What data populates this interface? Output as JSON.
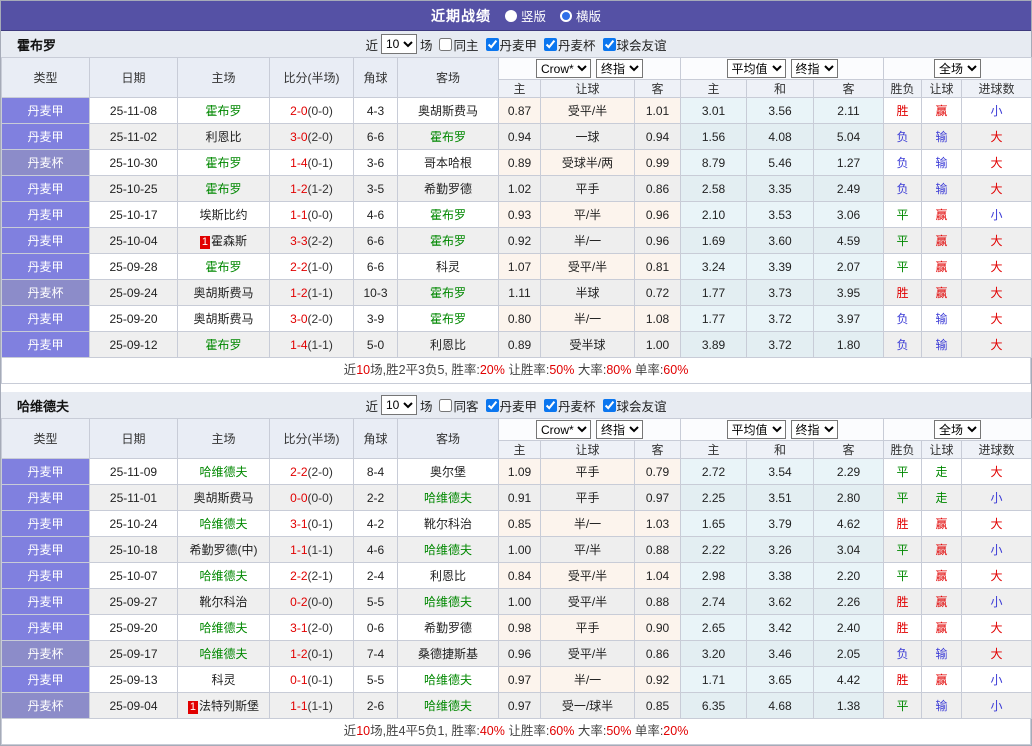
{
  "page": {
    "title": "近期战绩",
    "radio_options": [
      {
        "label": "竖版",
        "selected": true
      },
      {
        "label": "横版",
        "selected": false
      }
    ]
  },
  "colors": {
    "titlebar_bg": "#5551a5",
    "checkbox_accent": "#0b76ef",
    "score_red": "#e10000",
    "focus_team_green": "#008800",
    "league_badge": {
      "丹麦甲": "#8080df",
      "丹麦杯": "#8c8cc9"
    },
    "outcome": {
      "胜": "#e10000",
      "平": "#008800",
      "负": "#3c3cd6",
      "赢": "#e10000",
      "走": "#008800",
      "输": "#3c3cd6",
      "大": "#e10000",
      "小": "#3c3cd6"
    }
  },
  "filter_labels": {
    "near": "近",
    "count": "10",
    "games": "场",
    "leagues": [
      "丹麦甲",
      "丹麦杯",
      "球会友谊"
    ]
  },
  "header": {
    "cols": {
      "type": "类型",
      "date": "日期",
      "home": "主场",
      "score": "比分(半场)",
      "corner": "角球",
      "away": "客场"
    },
    "groups": {
      "crow": "Crow*",
      "crow_stage": "终指",
      "avg": "平均值",
      "avg_stage": "终指",
      "full": "全场"
    },
    "sub": [
      "主",
      "让球",
      "客",
      "主",
      "和",
      "客",
      "胜负",
      "让球",
      "进球数"
    ]
  },
  "sections": [
    {
      "team": "霍布罗",
      "same_label": "同主",
      "rows": [
        {
          "league": "丹麦甲",
          "date": "25-11-08",
          "home": "霍布罗",
          "home_focus": true,
          "home_badge": "",
          "score": "2-0",
          "half": "(0-0)",
          "corner": "4-3",
          "away": "奥胡斯费马",
          "away_focus": false,
          "odds": [
            "0.87",
            "受平/半",
            "1.01"
          ],
          "avg": [
            "3.01",
            "3.56",
            "2.11"
          ],
          "res": [
            "胜",
            "赢",
            "小"
          ]
        },
        {
          "league": "丹麦甲",
          "date": "25-11-02",
          "home": "利恩比",
          "home_focus": false,
          "home_badge": "",
          "score": "3-0",
          "half": "(2-0)",
          "corner": "6-6",
          "away": "霍布罗",
          "away_focus": true,
          "odds": [
            "0.94",
            "一球",
            "0.94"
          ],
          "avg": [
            "1.56",
            "4.08",
            "5.04"
          ],
          "res": [
            "负",
            "输",
            "大"
          ]
        },
        {
          "league": "丹麦杯",
          "date": "25-10-30",
          "home": "霍布罗",
          "home_focus": true,
          "home_badge": "",
          "score": "1-4",
          "half": "(0-1)",
          "corner": "3-6",
          "away": "哥本哈根",
          "away_focus": false,
          "odds": [
            "0.89",
            "受球半/两",
            "0.99"
          ],
          "avg": [
            "8.79",
            "5.46",
            "1.27"
          ],
          "res": [
            "负",
            "输",
            "大"
          ]
        },
        {
          "league": "丹麦甲",
          "date": "25-10-25",
          "home": "霍布罗",
          "home_focus": true,
          "home_badge": "",
          "score": "1-2",
          "half": "(1-2)",
          "corner": "3-5",
          "away": "希勤罗德",
          "away_focus": false,
          "odds": [
            "1.02",
            "平手",
            "0.86"
          ],
          "avg": [
            "2.58",
            "3.35",
            "2.49"
          ],
          "res": [
            "负",
            "输",
            "大"
          ]
        },
        {
          "league": "丹麦甲",
          "date": "25-10-17",
          "home": "埃斯比约",
          "home_focus": false,
          "home_badge": "",
          "score": "1-1",
          "half": "(0-0)",
          "corner": "4-6",
          "away": "霍布罗",
          "away_focus": true,
          "odds": [
            "0.93",
            "平/半",
            "0.96"
          ],
          "avg": [
            "2.10",
            "3.53",
            "3.06"
          ],
          "res": [
            "平",
            "赢",
            "小"
          ]
        },
        {
          "league": "丹麦甲",
          "date": "25-10-04",
          "home": "霍森斯",
          "home_focus": false,
          "home_badge": "1",
          "score": "3-3",
          "half": "(2-2)",
          "corner": "6-6",
          "away": "霍布罗",
          "away_focus": true,
          "odds": [
            "0.92",
            "半/一",
            "0.96"
          ],
          "avg": [
            "1.69",
            "3.60",
            "4.59"
          ],
          "res": [
            "平",
            "赢",
            "大"
          ]
        },
        {
          "league": "丹麦甲",
          "date": "25-09-28",
          "home": "霍布罗",
          "home_focus": true,
          "home_badge": "",
          "score": "2-2",
          "half": "(1-0)",
          "corner": "6-6",
          "away": "科灵",
          "away_focus": false,
          "odds": [
            "1.07",
            "受平/半",
            "0.81"
          ],
          "avg": [
            "3.24",
            "3.39",
            "2.07"
          ],
          "res": [
            "平",
            "赢",
            "大"
          ]
        },
        {
          "league": "丹麦杯",
          "date": "25-09-24",
          "home": "奥胡斯费马",
          "home_focus": false,
          "home_badge": "",
          "score": "1-2",
          "half": "(1-1)",
          "corner": "10-3",
          "away": "霍布罗",
          "away_focus": true,
          "odds": [
            "1.11",
            "半球",
            "0.72"
          ],
          "avg": [
            "1.77",
            "3.73",
            "3.95"
          ],
          "res": [
            "胜",
            "赢",
            "大"
          ]
        },
        {
          "league": "丹麦甲",
          "date": "25-09-20",
          "home": "奥胡斯费马",
          "home_focus": false,
          "home_badge": "",
          "score": "3-0",
          "half": "(2-0)",
          "corner": "3-9",
          "away": "霍布罗",
          "away_focus": true,
          "odds": [
            "0.80",
            "半/一",
            "1.08"
          ],
          "avg": [
            "1.77",
            "3.72",
            "3.97"
          ],
          "res": [
            "负",
            "输",
            "大"
          ]
        },
        {
          "league": "丹麦甲",
          "date": "25-09-12",
          "home": "霍布罗",
          "home_focus": true,
          "home_badge": "",
          "score": "1-4",
          "half": "(1-1)",
          "corner": "5-0",
          "away": "利恩比",
          "away_focus": false,
          "odds": [
            "0.89",
            "受半球",
            "1.00"
          ],
          "avg": [
            "3.89",
            "3.72",
            "1.80"
          ],
          "res": [
            "负",
            "输",
            "大"
          ]
        }
      ],
      "summary": [
        "近",
        "10",
        "场,胜2平3负5, 胜率:",
        "20%",
        " 让胜率:",
        "50%",
        " 大率:",
        "80%",
        " 单率:",
        "60%"
      ]
    },
    {
      "team": "哈维德夫",
      "same_label": "同客",
      "rows": [
        {
          "league": "丹麦甲",
          "date": "25-11-09",
          "home": "哈维德夫",
          "home_focus": true,
          "home_badge": "",
          "score": "2-2",
          "half": "(2-0)",
          "corner": "8-4",
          "away": "奥尔堡",
          "away_focus": false,
          "odds": [
            "1.09",
            "平手",
            "0.79"
          ],
          "avg": [
            "2.72",
            "3.54",
            "2.29"
          ],
          "res": [
            "平",
            "走",
            "大"
          ]
        },
        {
          "league": "丹麦甲",
          "date": "25-11-01",
          "home": "奥胡斯费马",
          "home_focus": false,
          "home_badge": "",
          "score": "0-0",
          "half": "(0-0)",
          "corner": "2-2",
          "away": "哈维德夫",
          "away_focus": true,
          "odds": [
            "0.91",
            "平手",
            "0.97"
          ],
          "avg": [
            "2.25",
            "3.51",
            "2.80"
          ],
          "res": [
            "平",
            "走",
            "小"
          ]
        },
        {
          "league": "丹麦甲",
          "date": "25-10-24",
          "home": "哈维德夫",
          "home_focus": true,
          "home_badge": "",
          "score": "3-1",
          "half": "(0-1)",
          "corner": "4-2",
          "away": "靴尔科治",
          "away_focus": false,
          "odds": [
            "0.85",
            "半/一",
            "1.03"
          ],
          "avg": [
            "1.65",
            "3.79",
            "4.62"
          ],
          "res": [
            "胜",
            "赢",
            "大"
          ]
        },
        {
          "league": "丹麦甲",
          "date": "25-10-18",
          "home": "希勤罗德(中)",
          "home_focus": false,
          "home_badge": "",
          "score": "1-1",
          "half": "(1-1)",
          "corner": "4-6",
          "away": "哈维德夫",
          "away_focus": true,
          "odds": [
            "1.00",
            "平/半",
            "0.88"
          ],
          "avg": [
            "2.22",
            "3.26",
            "3.04"
          ],
          "res": [
            "平",
            "赢",
            "小"
          ]
        },
        {
          "league": "丹麦甲",
          "date": "25-10-07",
          "home": "哈维德夫",
          "home_focus": true,
          "home_badge": "",
          "score": "2-2",
          "half": "(2-1)",
          "corner": "2-4",
          "away": "利恩比",
          "away_focus": false,
          "odds": [
            "0.84",
            "受平/半",
            "1.04"
          ],
          "avg": [
            "2.98",
            "3.38",
            "2.20"
          ],
          "res": [
            "平",
            "赢",
            "大"
          ]
        },
        {
          "league": "丹麦甲",
          "date": "25-09-27",
          "home": "靴尔科治",
          "home_focus": false,
          "home_badge": "",
          "score": "0-2",
          "half": "(0-0)",
          "corner": "5-5",
          "away": "哈维德夫",
          "away_focus": true,
          "odds": [
            "1.00",
            "受平/半",
            "0.88"
          ],
          "avg": [
            "2.74",
            "3.62",
            "2.26"
          ],
          "res": [
            "胜",
            "赢",
            "小"
          ]
        },
        {
          "league": "丹麦甲",
          "date": "25-09-20",
          "home": "哈维德夫",
          "home_focus": true,
          "home_badge": "",
          "score": "3-1",
          "half": "(2-0)",
          "corner": "0-6",
          "away": "希勤罗德",
          "away_focus": false,
          "odds": [
            "0.98",
            "平手",
            "0.90"
          ],
          "avg": [
            "2.65",
            "3.42",
            "2.40"
          ],
          "res": [
            "胜",
            "赢",
            "大"
          ]
        },
        {
          "league": "丹麦杯",
          "date": "25-09-17",
          "home": "哈维德夫",
          "home_focus": true,
          "home_badge": "",
          "score": "1-2",
          "half": "(0-1)",
          "corner": "7-4",
          "away": "桑德捷斯基",
          "away_focus": false,
          "odds": [
            "0.96",
            "受平/半",
            "0.86"
          ],
          "avg": [
            "3.20",
            "3.46",
            "2.05"
          ],
          "res": [
            "负",
            "输",
            "大"
          ]
        },
        {
          "league": "丹麦甲",
          "date": "25-09-13",
          "home": "科灵",
          "home_focus": false,
          "home_badge": "",
          "score": "0-1",
          "half": "(0-1)",
          "corner": "5-5",
          "away": "哈维德夫",
          "away_focus": true,
          "odds": [
            "0.97",
            "半/一",
            "0.92"
          ],
          "avg": [
            "1.71",
            "3.65",
            "4.42"
          ],
          "res": [
            "胜",
            "赢",
            "小"
          ]
        },
        {
          "league": "丹麦杯",
          "date": "25-09-04",
          "home": "法特列斯堡",
          "home_focus": false,
          "home_badge": "1",
          "score": "1-1",
          "half": "(1-1)",
          "corner": "2-6",
          "away": "哈维德夫",
          "away_focus": true,
          "odds": [
            "0.97",
            "受一/球半",
            "0.85"
          ],
          "avg": [
            "6.35",
            "4.68",
            "1.38"
          ],
          "res": [
            "平",
            "输",
            "小"
          ]
        }
      ],
      "summary": [
        "近",
        "10",
        "场,胜4平5负1, 胜率:",
        "40%",
        " 让胜率:",
        "60%",
        " 大率:",
        "50%",
        " 单率:",
        "20%"
      ]
    }
  ]
}
